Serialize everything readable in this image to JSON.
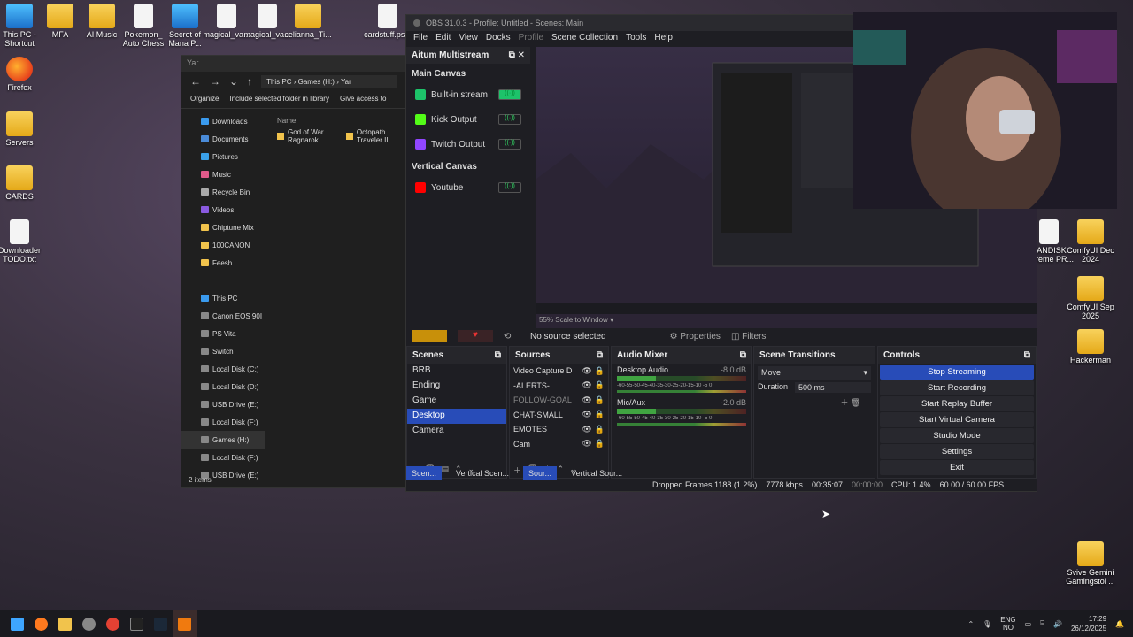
{
  "desktop_left": [
    {
      "name": "This PC - Shortcut",
      "kind": "pc"
    },
    {
      "name": "Firefox",
      "kind": "fox"
    },
    {
      "name": "Servers",
      "kind": "folder"
    },
    {
      "name": "CARDS",
      "kind": "folder"
    },
    {
      "name": "Downloader TODO.txt",
      "kind": "file"
    }
  ],
  "desktop_top": [
    "MFA",
    "AI Music",
    "Pokemon_ Auto Chess",
    "Secret of Mana P...",
    "magical_va...",
    "magical_va...",
    "celianna_Ti...",
    "cardstuff.ps..."
  ],
  "desktop_right": [
    "SANDISK Extreme PR...",
    "ComfyUI Dec 2024",
    "ComfyUI Sep 2025",
    "Hackerman",
    "Svive Gemini Gamingstol ..."
  ],
  "explorer": {
    "title": "Yar",
    "path": [
      "This PC",
      "Games (H:)",
      "Yar"
    ],
    "toolbar": [
      "Organize",
      "Include selected folder in library",
      "Give access to"
    ],
    "column_header": "Name",
    "tree": [
      "Downloads",
      "Documents",
      "Pictures",
      "Music",
      "Recycle Bin",
      "Videos",
      "Chiptune Mix",
      "100CANON",
      "Feesh",
      "This PC",
      "Canon EOS 90I",
      "PS Vita",
      "Switch",
      "Local Disk (C:)",
      "Local Disk (D:)",
      "USB Drive (E:)",
      "Local Disk (F:)",
      "Games (H:)",
      "Local Disk (F:)",
      "USB Drive (E:)"
    ],
    "files": [
      "God of War Ragnarok",
      "Octopath Traveler II"
    ],
    "status": "2 items"
  },
  "obs": {
    "title": "OBS 31.0.3 - Profile: Untitled - Scenes: Main",
    "menu": [
      "File",
      "Edit",
      "View",
      "Docks",
      "Profile",
      "Scene Collection",
      "Tools",
      "Help"
    ],
    "multistream": {
      "title": "Aitum Multistream",
      "main_canvas": "Main Canvas",
      "outputs": [
        {
          "name": "Built-in stream",
          "color": "#1dc36a",
          "active": true
        },
        {
          "name": "Kick Output",
          "color": "#53fc18",
          "active": false
        },
        {
          "name": "Twitch Output",
          "color": "#9146ff",
          "active": false
        }
      ],
      "vertical_canvas": "Vertical Canvas",
      "vertical_outputs": [
        {
          "name": "Youtube",
          "color": "#ff0000",
          "active": false
        }
      ]
    },
    "preview_zoom": "55%",
    "preview_mode": "Scale to Window",
    "no_source": "No source selected",
    "properties": "Properties",
    "filters": "Filters",
    "scenes": {
      "title": "Scenes",
      "items": [
        "BRB",
        "Ending",
        "Game",
        "Desktop",
        "Camera"
      ],
      "selected": "Desktop"
    },
    "sources": {
      "title": "Sources",
      "items": [
        "Video Capture D",
        "-ALERTS-",
        "FOLLOW-GOAL",
        "CHAT-SMALL",
        "EMOTES",
        "Cam"
      ]
    },
    "mixer": {
      "title": "Audio Mixer",
      "channels": [
        {
          "name": "Desktop Audio",
          "db": "-8.0 dB"
        },
        {
          "name": "Mic/Aux",
          "db": "-2.0 dB"
        }
      ],
      "scale": "-60-55-50-45-40-35-30-25-20-15-10 -5 0"
    },
    "transitions": {
      "title": "Scene Transitions",
      "type": "Move",
      "duration_label": "Duration",
      "duration": "500 ms"
    },
    "controls": {
      "title": "Controls",
      "buttons": [
        "Stop Streaming",
        "Start Recording",
        "Start Replay Buffer",
        "Start Virtual Camera",
        "Studio Mode",
        "Settings",
        "Exit"
      ]
    },
    "tabs": [
      "Scen...",
      "Vertical Scen...",
      "Sour...",
      "Vertical Sour..."
    ],
    "status": {
      "dropped": "Dropped Frames 1188 (1.2%)",
      "bitrate": "7778 kbps",
      "stream_time": "00:35:07",
      "rec_time": "00:00:00",
      "cpu": "CPU: 1.4%",
      "fps": "60.00 / 60.00 FPS"
    }
  },
  "tray": {
    "lang1": "ENG",
    "lang2": "NO",
    "time": "17:29",
    "date": "26/12/2025"
  }
}
